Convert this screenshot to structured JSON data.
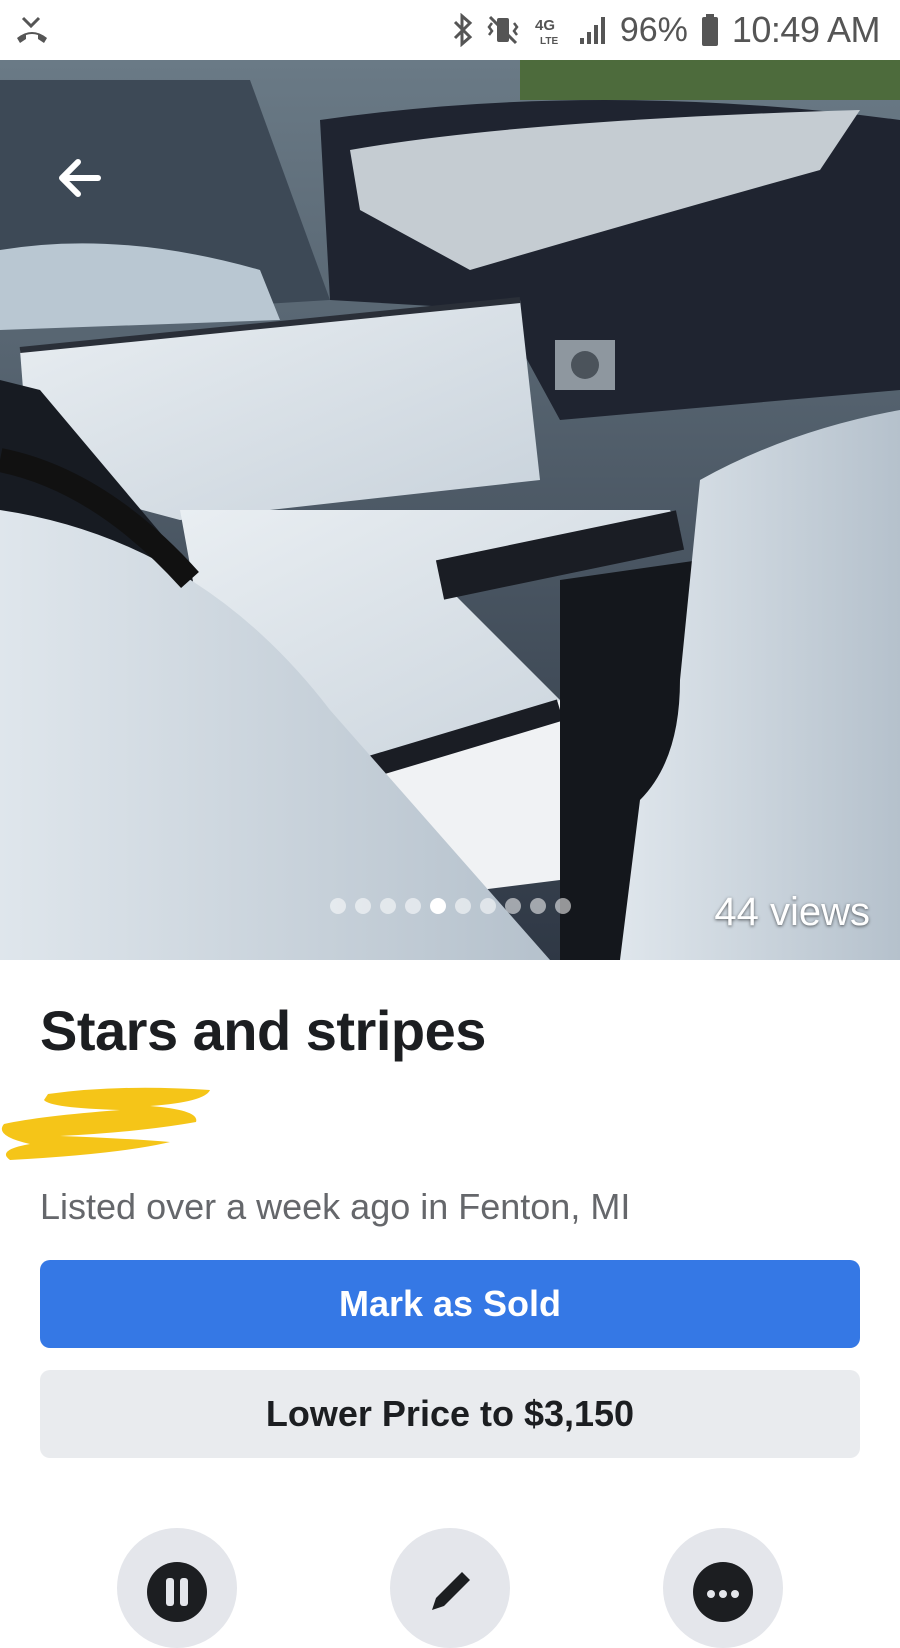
{
  "status_bar": {
    "battery": "96%",
    "time": "10:49 AM",
    "network": "4G LTE",
    "icons": [
      "missed-call-icon",
      "bluetooth-icon",
      "vibrate-icon",
      "lte-icon",
      "signal-icon",
      "battery-icon"
    ]
  },
  "listing": {
    "photo": {
      "views": "44 views",
      "page_count": 10,
      "active_page": 5
    },
    "title": "Stars and stripes",
    "meta": "Listed over a week ago in Fenton, MI"
  },
  "buttons": {
    "mark_sold": "Mark as Sold",
    "lower_price": "Lower Price to $3,150"
  },
  "actions": [
    "pause-icon",
    "edit-icon",
    "more-icon"
  ],
  "colors": {
    "primary": "#3578e5",
    "secondary_bg": "#e9ebee",
    "redaction": "#f5c518"
  }
}
